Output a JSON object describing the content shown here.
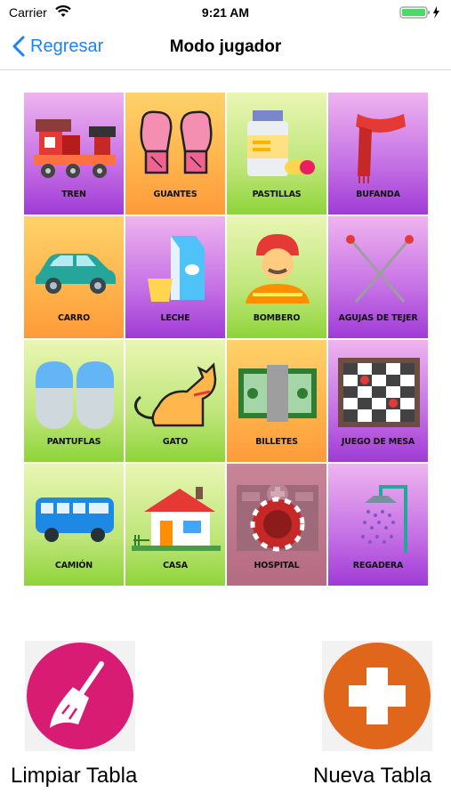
{
  "status": {
    "carrier": "Carrier",
    "time": "9:21 AM"
  },
  "nav": {
    "back_label": "Regresar",
    "title": "Modo jugador"
  },
  "cards": [
    {
      "label": "TREN",
      "icon": "train-icon",
      "bg": "purple"
    },
    {
      "label": "GUANTES",
      "icon": "boxing-gloves-icon",
      "bg": "orange"
    },
    {
      "label": "PASTILLAS",
      "icon": "pills-icon",
      "bg": "green"
    },
    {
      "label": "BUFANDA",
      "icon": "scarf-icon",
      "bg": "purple"
    },
    {
      "label": "CARRO",
      "icon": "car-icon",
      "bg": "orange"
    },
    {
      "label": "LECHE",
      "icon": "milk-icon",
      "bg": "purple"
    },
    {
      "label": "BOMBERO",
      "icon": "firefighter-icon",
      "bg": "green"
    },
    {
      "label": "AGUJAS DE TEJER",
      "icon": "knitting-needles-icon",
      "bg": "purple"
    },
    {
      "label": "PANTUFLAS",
      "icon": "slippers-icon",
      "bg": "green"
    },
    {
      "label": "GATO",
      "icon": "cat-icon",
      "bg": "green"
    },
    {
      "label": "BILLETES",
      "icon": "banknotes-icon",
      "bg": "orange"
    },
    {
      "label": "JUEGO DE MESA",
      "icon": "checkers-board-icon",
      "bg": "purple"
    },
    {
      "label": "CAMIÓN",
      "icon": "bus-icon",
      "bg": "green"
    },
    {
      "label": "CASA",
      "icon": "house-icon",
      "bg": "green"
    },
    {
      "label": "HOSPITAL",
      "icon": "hospital-icon",
      "bg": "marked",
      "marked": true
    },
    {
      "label": "REGADERA",
      "icon": "shower-icon",
      "bg": "purple"
    }
  ],
  "actions": {
    "clear_label": "Limpiar Tabla",
    "new_label": "Nueva Tabla"
  },
  "colors": {
    "accent": "#1a82fb",
    "clear": "#d81b73",
    "new": "#e0661c",
    "chip": "#c62828"
  }
}
